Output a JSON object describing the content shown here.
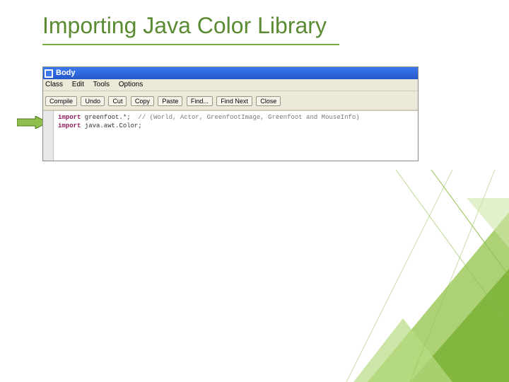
{
  "slide": {
    "title": "Importing Java Color Library"
  },
  "editor": {
    "titlebar": "Body",
    "menus": {
      "class": "Class",
      "edit": "Edit",
      "tools": "Tools",
      "options": "Options"
    },
    "toolbar": {
      "compile": "Compile",
      "undo": "Undo",
      "cut": "Cut",
      "copy": "Copy",
      "paste": "Paste",
      "find": "Find...",
      "findnext": "Find Next",
      "close": "Close"
    },
    "code": {
      "kw_import1": "import",
      "line1_rest": " greenfoot.*;  ",
      "line1_comment": "// (World, Actor, GreenfootImage, Greenfoot and MouseInfo)",
      "kw_import2": "import",
      "line2_rest": " java.awt.Color;"
    }
  }
}
